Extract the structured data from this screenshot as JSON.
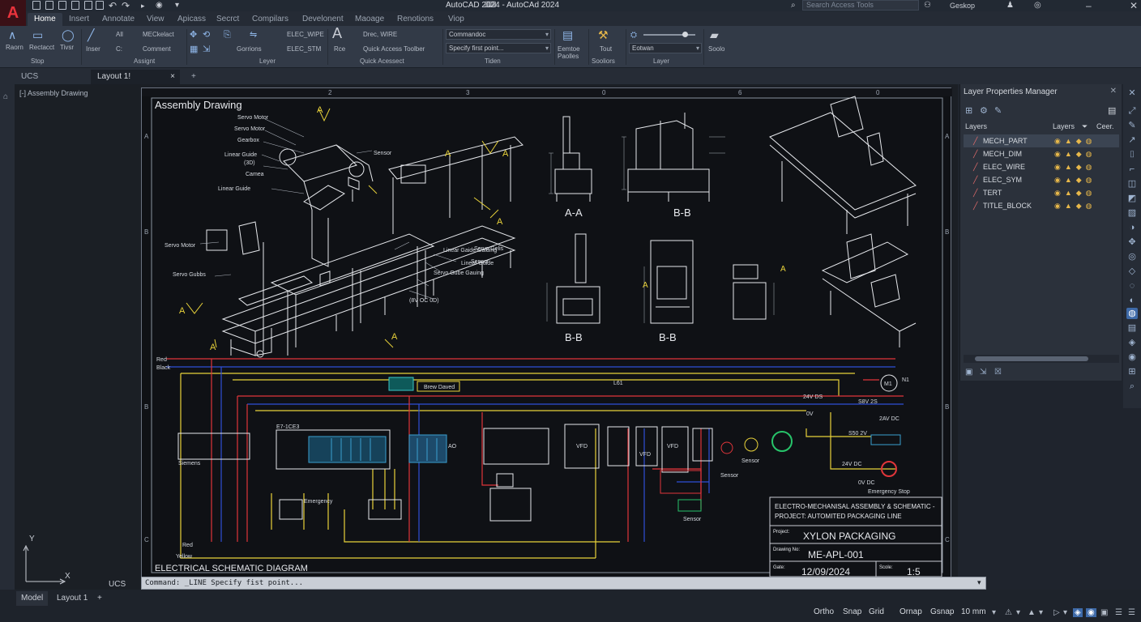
{
  "titlebar": {
    "title": "AutoCAD 2024 - AutoCAd 2024",
    "search_placeholder": "Search Access Tools",
    "user": "Geskop",
    "logo": "A"
  },
  "ribbon_tabs": [
    "Home",
    "Insert",
    "Annotate",
    "View",
    "Apicass",
    "Secrct",
    "Compilars",
    "Develonent",
    "Maoage",
    "Renotions",
    "Viop"
  ],
  "ribbon": {
    "draw_buttons": [
      "Raorn",
      "Rectacct",
      "Tivsr",
      "Inser"
    ],
    "draw_group": "Stop",
    "modify_items": [
      "All",
      "MECkelact",
      "Comment",
      "C:",
      "Gorrions",
      "ELEC_WIPE",
      "ELEC_STM"
    ],
    "modify_group": "Assignt",
    "layer_group": "Leyer",
    "annotation": {
      "big_label": "A",
      "under_big": "Rce",
      "item1": "Drec, WIRE",
      "item2": "Quick Access Toolber",
      "group": "Quick Acessect"
    },
    "combo1": "Commandoc",
    "combo2": "Specify first point...",
    "tiden_group": "Tiden",
    "eemtoe_label": "Eemtoe",
    "eemtoe_sub": "Paolles",
    "tools": {
      "label": "Tout",
      "group": "Sooliors"
    },
    "layer_combo": "Eotwan",
    "layer_group2": "Layer",
    "soolo": "Soolo"
  },
  "doc_tabs": {
    "ucs": "UCS",
    "layout": "Layout 1!",
    "close": "×",
    "add": "+"
  },
  "viewport": {
    "label": "[-] Assembly Drawing"
  },
  "drawing": {
    "assembly_title": "Assembly Drawing",
    "schematic_title": "ELECTRICAL SCHEMATIC DIAGRAM",
    "col_labels": [
      "2",
      "3",
      "0",
      "6",
      "0"
    ],
    "row_labels": [
      "A",
      "B",
      "B",
      "C"
    ],
    "section_labels": [
      "A-A",
      "B-B",
      "B-B",
      "B-B"
    ],
    "callouts": [
      "Servo Motor",
      "Servo Motor",
      "Gearbox",
      "Linear Guide",
      "(3D)",
      "Camea",
      "Linear Guide",
      "Servo Motor",
      "Servo Gubbs",
      "Sensor",
      "Linear Gaide Gaiding",
      "Servo Gube Gauing",
      "Linear Guide",
      "(8V OC 0D)",
      "Sensor",
      "Servo Gelis"
    ],
    "schematic_labels": [
      "Red",
      "Black",
      "Brew Daved",
      "L61",
      "24V DS",
      "S8V 2S",
      "2AV DC",
      "0V",
      "S50 2V",
      "24V DC",
      "0V DC",
      "M1",
      "N1",
      "E7-1CE3",
      "VFD",
      "VFD",
      "VFD",
      "AO",
      "Siemens",
      "Emergency",
      "Sensor",
      "Sensor",
      "Emergency Stop",
      "Sensor",
      "Red",
      "Yellow"
    ],
    "title_block": {
      "heading": "ELECTRO-MECHANISAL ASSEMBLY & SCHEMATIC - PROJECT: AUTOMITED PACKAGING LINE",
      "project_label": "Project:",
      "project": "XYLON PACKAGING",
      "drawing_label": "Drawing No:",
      "drawing_no": "ME-APL-001",
      "date_label": "Gate:",
      "date": "12/09/2024",
      "scale_label": "Scole:",
      "scale": "1:5"
    }
  },
  "layer_panel": {
    "title": "Layer Properties Manager",
    "col_layers": "Layers",
    "col_layers2": "Layers",
    "col_color": "Ceer.",
    "layers": [
      {
        "name": "MECH_PART",
        "current": true
      },
      {
        "name": "MECH_DIM",
        "current": false
      },
      {
        "name": "ELEC_WIRE",
        "current": false
      },
      {
        "name": "ELEC_SYM",
        "current": false
      },
      {
        "name": "TERT",
        "current": false
      },
      {
        "name": "TITLE_BLOCK",
        "current": false
      }
    ]
  },
  "command": {
    "ucs_label": "UCS",
    "text": "Command: _LINE Specify fist point..."
  },
  "statusbar": {
    "tabs": [
      "Model",
      "Layout 1",
      "+"
    ],
    "buttons": [
      "Ortho",
      "Snap",
      "Grid",
      "Ornap",
      "Gsnap",
      "10 mm"
    ]
  },
  "colors": {
    "accent": "#3e6aa8",
    "wire_red": "#e0353a",
    "wire_blue": "#2f4fd8",
    "wire_yellow": "#e8d23a",
    "layer_yellow": "#e8b84a",
    "mech_white": "#e6e8ec"
  }
}
